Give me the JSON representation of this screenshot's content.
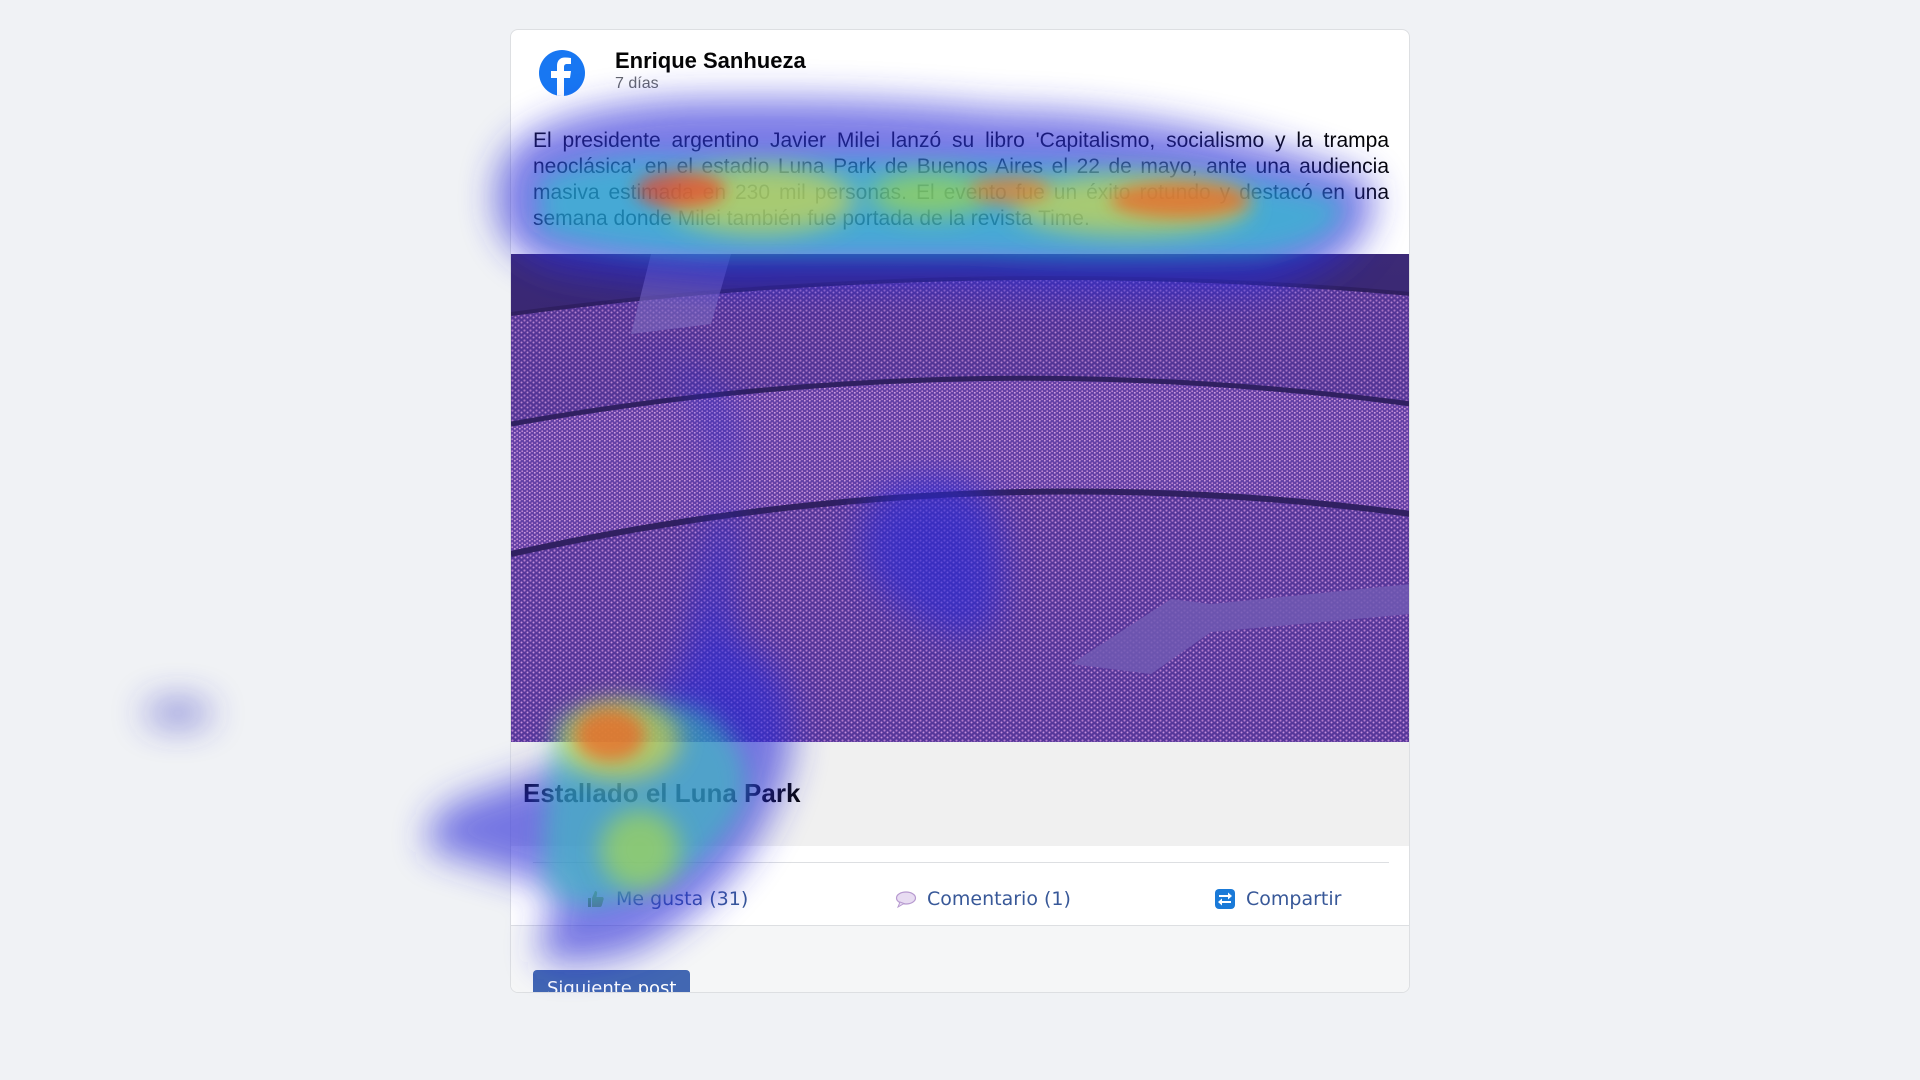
{
  "post": {
    "author": "Enrique Sanhueza",
    "time": "7 días",
    "text": "El presidente argentino Javier Milei lanzó su libro 'Capitalismo, socialismo y la trampa neoclásica' en el estadio Luna Park de Buenos Aires el 22 de mayo, ante una audiencia masiva estimada en 230 mil personas. El evento fue un éxito rotundo y destacó en una semana donde Milei también fue portada de la revista Time.",
    "link_title": "Estallado el Luna Park"
  },
  "actions": {
    "like_label": "Me gusta (31)",
    "comment_label": "Comentario (1)",
    "share_label": "Compartir"
  },
  "footer": {
    "next_label": "Siguiente post"
  },
  "icons": {
    "brand": "facebook-logo-icon",
    "like": "thumbs-up-icon",
    "comment": "speech-bubble-icon",
    "share": "share-icon"
  },
  "colors": {
    "facebook_blue": "#1877f2",
    "link_blue": "#385898",
    "button_blue": "#4267b2",
    "page_background": "#f0f2f5"
  }
}
